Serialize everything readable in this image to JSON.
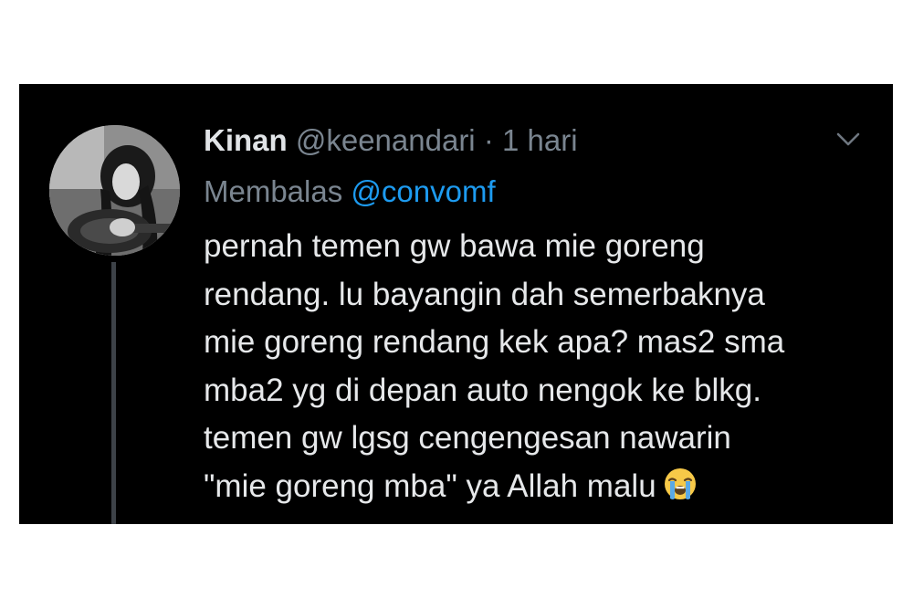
{
  "tweet": {
    "author_name": "Kinan",
    "handle": "@keenandari",
    "separator": "·",
    "time": "1 hari",
    "reply_label": "Membalas",
    "reply_to": "@convomf",
    "text_lines": [
      "pernah temen gw bawa mie goreng",
      "rendang. lu bayangin dah semerbaknya",
      "mie goreng rendang kek apa? mas2 sma",
      "mba2 yg di depan auto nengok ke blkg.",
      "temen gw lgsg cengengesan nawarin",
      "\"mie goreng mba\" ya Allah malu"
    ],
    "emoji": "loudly-crying-face",
    "more_icon": "chevron-down-icon"
  },
  "colors": {
    "background": "#000000",
    "frame": "#ffffff",
    "name": "#e1e4e7",
    "muted": "#7a8590",
    "link": "#1d9bf0",
    "text": "#e6e8ea"
  }
}
